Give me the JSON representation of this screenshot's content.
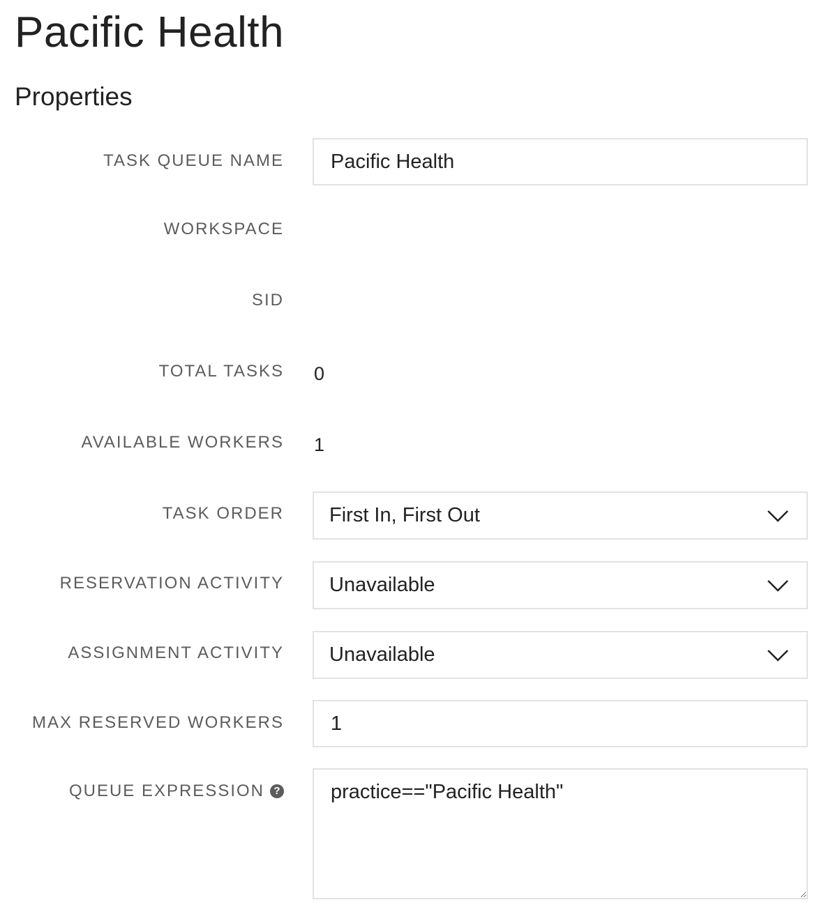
{
  "page": {
    "title": "Pacific Health",
    "section_title": "Properties"
  },
  "fields": {
    "task_queue_name": {
      "label": "TASK QUEUE NAME",
      "value": "Pacific Health"
    },
    "workspace": {
      "label": "WORKSPACE",
      "value": ""
    },
    "sid": {
      "label": "SID",
      "value": ""
    },
    "total_tasks": {
      "label": "TOTAL TASKS",
      "value": "0"
    },
    "available_workers": {
      "label": "AVAILABLE WORKERS",
      "value": "1"
    },
    "task_order": {
      "label": "TASK ORDER",
      "value": "First In, First Out"
    },
    "reservation_activity": {
      "label": "RESERVATION ACTIVITY",
      "value": "Unavailable"
    },
    "assignment_activity": {
      "label": "ASSIGNMENT ACTIVITY",
      "value": "Unavailable"
    },
    "max_reserved_workers": {
      "label": "MAX RESERVED WORKERS",
      "value": "1"
    },
    "queue_expression": {
      "label": "QUEUE EXPRESSION",
      "value": "practice==\"Pacific Health\"",
      "help_icon": "question-circle-icon"
    }
  },
  "icons": {
    "dropdown": "chevron-down-icon",
    "help": "question-circle-icon"
  }
}
